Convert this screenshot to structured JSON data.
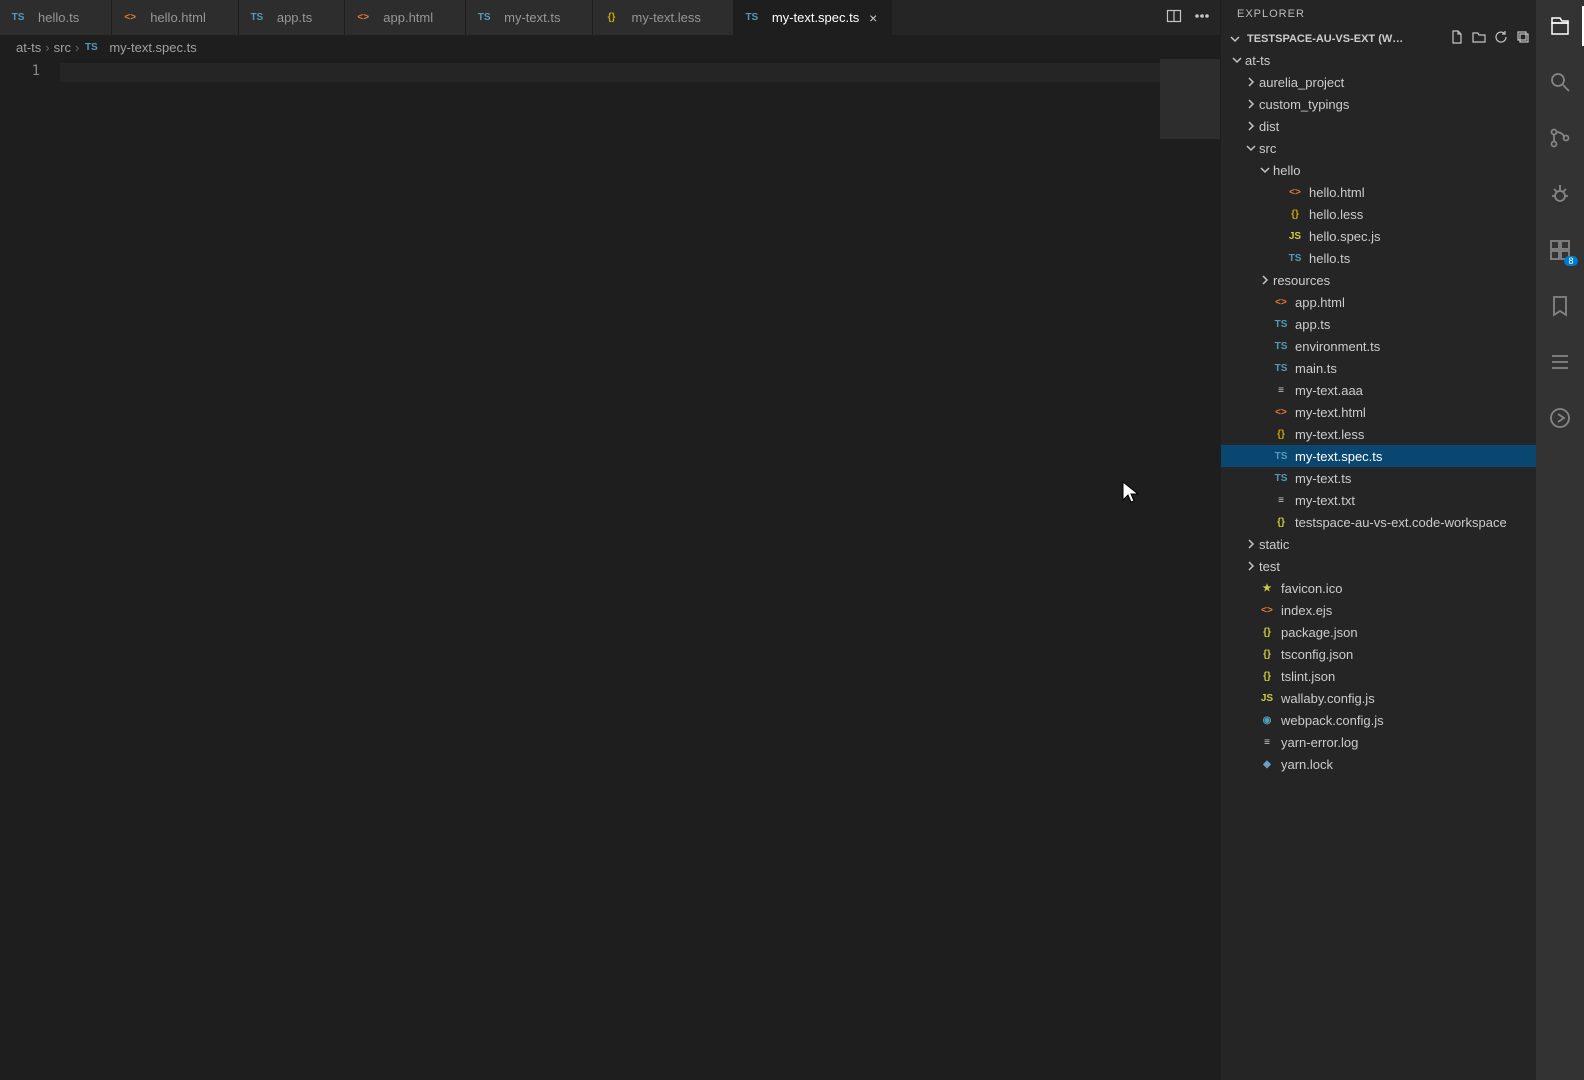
{
  "explorer_title": "EXPLORER",
  "workspace_name": "TESTSPACE-AU-VS-EXT (W…",
  "tabs": [
    {
      "icon": "ts",
      "label": "hello.ts",
      "active": false
    },
    {
      "icon": "html",
      "label": "hello.html",
      "active": false
    },
    {
      "icon": "ts",
      "label": "app.ts",
      "active": false
    },
    {
      "icon": "html",
      "label": "app.html",
      "active": false
    },
    {
      "icon": "ts",
      "label": "my-text.ts",
      "active": false
    },
    {
      "icon": "less",
      "label": "my-text.less",
      "active": false
    },
    {
      "icon": "ts",
      "label": "my-text.spec.ts",
      "active": true
    }
  ],
  "breadcrumb": [
    "at-ts",
    "src",
    "my-text.spec.ts"
  ],
  "breadcrumb_icon": "ts",
  "editor": {
    "line_number": "1"
  },
  "extensions_badge": "8",
  "tree": [
    {
      "depth": 0,
      "type": "folder",
      "open": true,
      "label": "at-ts"
    },
    {
      "depth": 1,
      "type": "folder",
      "open": false,
      "label": "aurelia_project"
    },
    {
      "depth": 1,
      "type": "folder",
      "open": false,
      "label": "custom_typings"
    },
    {
      "depth": 1,
      "type": "folder",
      "open": false,
      "label": "dist"
    },
    {
      "depth": 1,
      "type": "folder",
      "open": true,
      "label": "src"
    },
    {
      "depth": 2,
      "type": "folder",
      "open": true,
      "label": "hello"
    },
    {
      "depth": 3,
      "type": "file",
      "icon": "html",
      "label": "hello.html"
    },
    {
      "depth": 3,
      "type": "file",
      "icon": "less",
      "label": "hello.less"
    },
    {
      "depth": 3,
      "type": "file",
      "icon": "js",
      "label": "hello.spec.js"
    },
    {
      "depth": 3,
      "type": "file",
      "icon": "ts",
      "label": "hello.ts"
    },
    {
      "depth": 2,
      "type": "folder",
      "open": false,
      "label": "resources"
    },
    {
      "depth": 2,
      "type": "file",
      "icon": "html",
      "label": "app.html"
    },
    {
      "depth": 2,
      "type": "file",
      "icon": "ts",
      "label": "app.ts"
    },
    {
      "depth": 2,
      "type": "file",
      "icon": "ts",
      "label": "environment.ts"
    },
    {
      "depth": 2,
      "type": "file",
      "icon": "ts",
      "label": "main.ts"
    },
    {
      "depth": 2,
      "type": "file",
      "icon": "txt",
      "label": "my-text.aaa"
    },
    {
      "depth": 2,
      "type": "file",
      "icon": "html",
      "label": "my-text.html"
    },
    {
      "depth": 2,
      "type": "file",
      "icon": "less",
      "label": "my-text.less"
    },
    {
      "depth": 2,
      "type": "file",
      "icon": "ts",
      "label": "my-text.spec.ts",
      "selected": true
    },
    {
      "depth": 2,
      "type": "file",
      "icon": "ts",
      "label": "my-text.ts"
    },
    {
      "depth": 2,
      "type": "file",
      "icon": "txt",
      "label": "my-text.txt"
    },
    {
      "depth": 2,
      "type": "file",
      "icon": "json",
      "label": "testspace-au-vs-ext.code-workspace"
    },
    {
      "depth": 1,
      "type": "folder",
      "open": false,
      "label": "static"
    },
    {
      "depth": 1,
      "type": "folder",
      "open": false,
      "label": "test"
    },
    {
      "depth": 1,
      "type": "file",
      "icon": "ico",
      "label": "favicon.ico"
    },
    {
      "depth": 1,
      "type": "file",
      "icon": "html",
      "label": "index.ejs"
    },
    {
      "depth": 1,
      "type": "file",
      "icon": "json",
      "label": "package.json"
    },
    {
      "depth": 1,
      "type": "file",
      "icon": "json",
      "label": "tsconfig.json"
    },
    {
      "depth": 1,
      "type": "file",
      "icon": "json",
      "label": "tslint.json"
    },
    {
      "depth": 1,
      "type": "file",
      "icon": "js",
      "label": "wallaby.config.js"
    },
    {
      "depth": 1,
      "type": "file",
      "icon": "cfg",
      "label": "webpack.config.js"
    },
    {
      "depth": 1,
      "type": "file",
      "icon": "txt",
      "label": "yarn-error.log"
    },
    {
      "depth": 1,
      "type": "file",
      "icon": "lock",
      "label": "yarn.lock"
    }
  ]
}
